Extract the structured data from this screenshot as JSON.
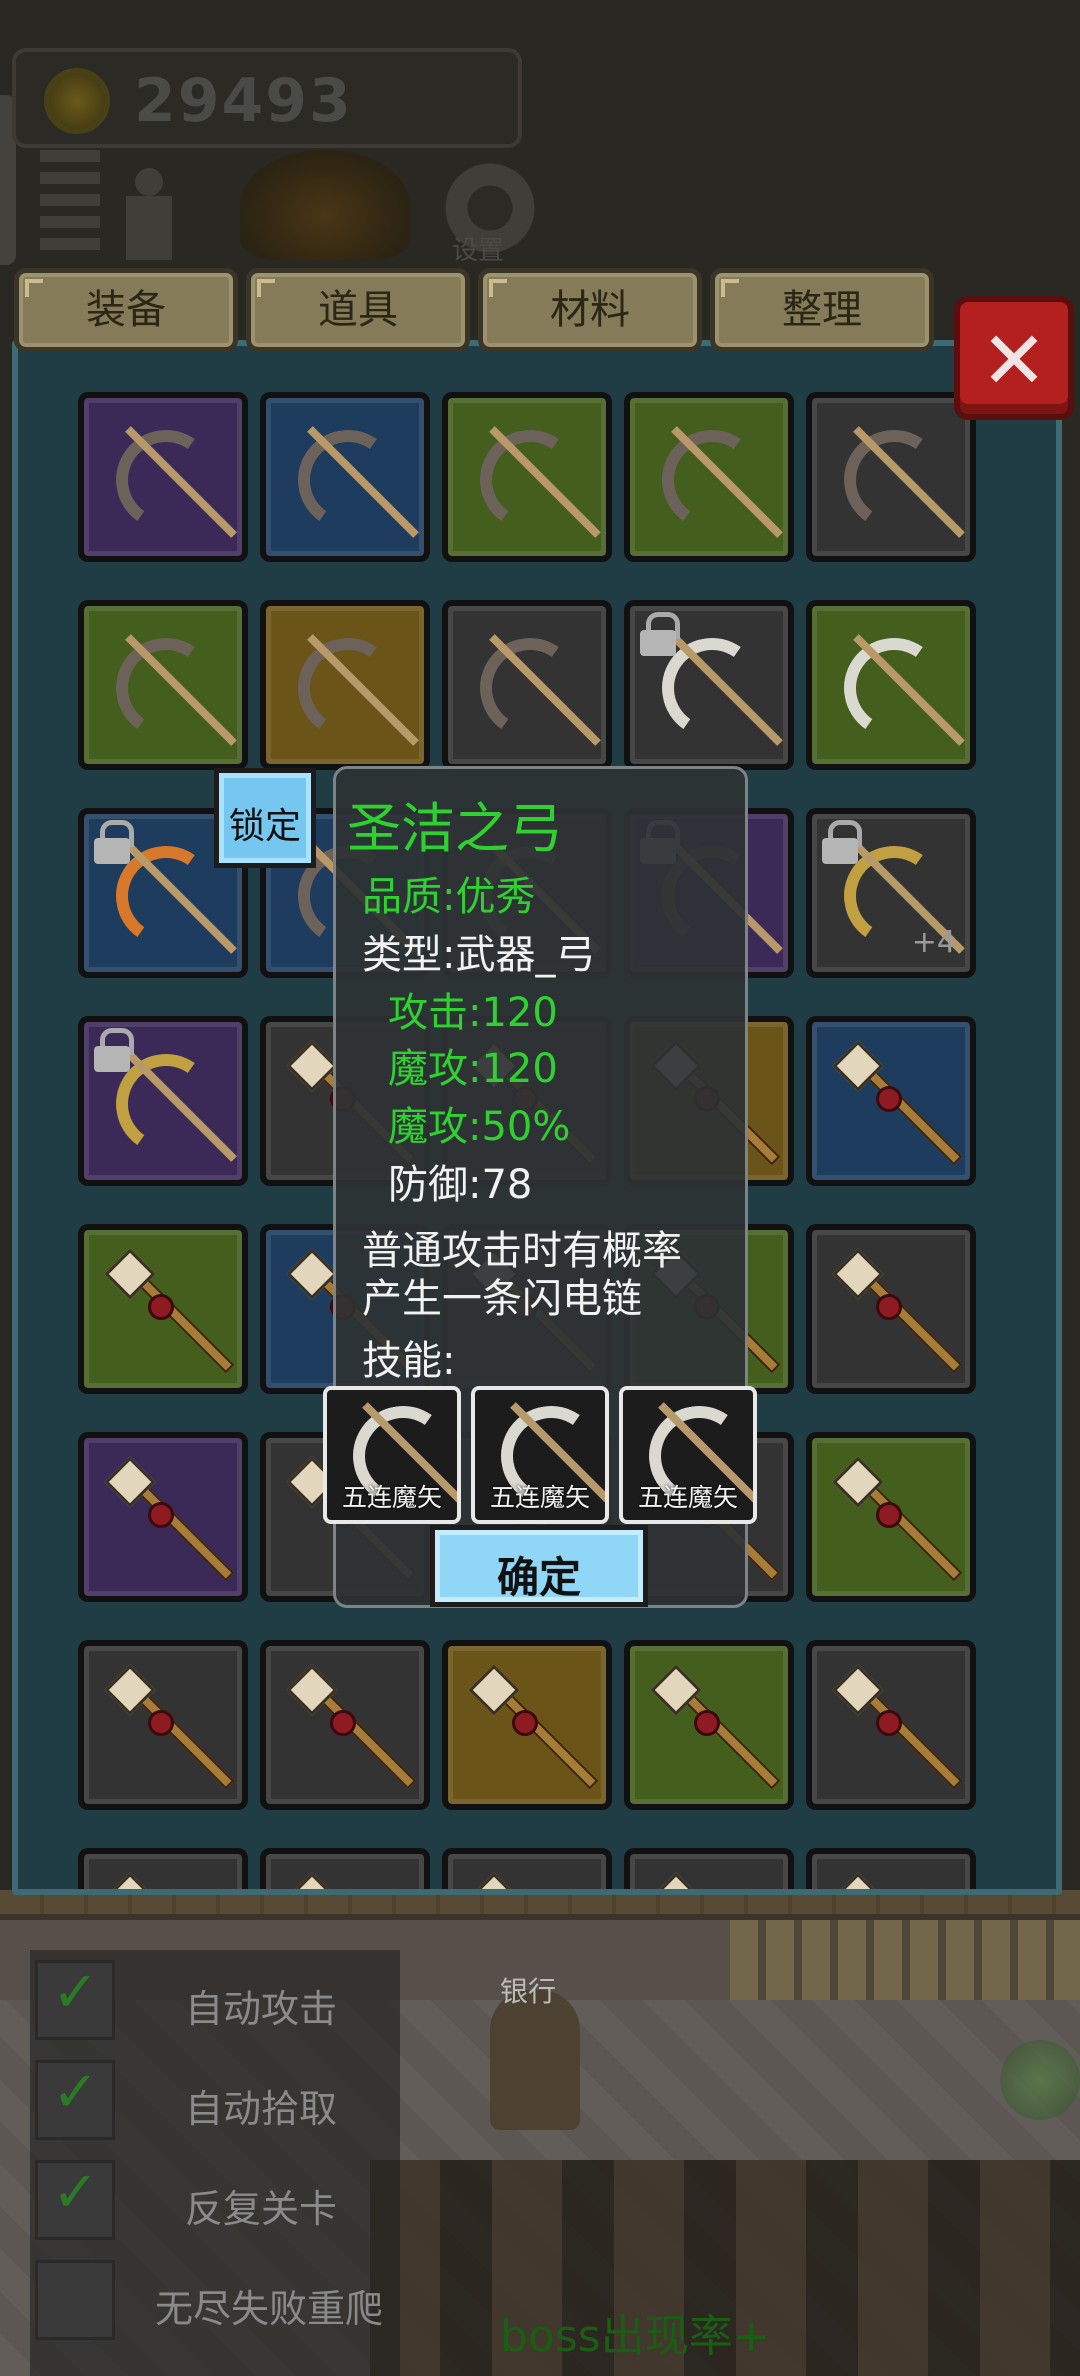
{
  "hud": {
    "gold": "29493",
    "settings_label": "设置"
  },
  "tabs": [
    "装备",
    "道具",
    "材料",
    "整理"
  ],
  "close_label": "✕",
  "grid": {
    "rows": [
      [
        {
          "q": "purple",
          "icon": "bow",
          "arc": "dark"
        },
        {
          "q": "blue",
          "icon": "bow",
          "arc": "dark"
        },
        {
          "q": "green",
          "icon": "bow",
          "arc": "dark"
        },
        {
          "q": "green",
          "icon": "bow",
          "arc": "dark"
        },
        {
          "q": "gray",
          "icon": "bow",
          "arc": "dark"
        }
      ],
      [
        {
          "q": "green",
          "icon": "bow",
          "arc": "dark"
        },
        {
          "q": "gold",
          "icon": "bow",
          "arc": "dark"
        },
        {
          "q": "gray",
          "icon": "bow",
          "arc": "dark"
        },
        {
          "q": "gray",
          "icon": "bow",
          "arc": "white",
          "locked": true
        },
        {
          "q": "green",
          "icon": "bow",
          "arc": "white"
        }
      ],
      [
        {
          "q": "blue",
          "icon": "bow",
          "arc": "fire",
          "locked": true
        },
        {
          "q": "blue",
          "icon": "bow",
          "arc": "dark"
        },
        {
          "q": "gray",
          "icon": "bow",
          "arc": "dark"
        },
        {
          "q": "purple",
          "icon": "bow",
          "arc": "dark",
          "locked": true
        },
        {
          "q": "gray",
          "icon": "bow",
          "arc": "gold",
          "locked": true,
          "plus": "+4"
        }
      ],
      [
        {
          "q": "purple",
          "icon": "bow",
          "arc": "gold",
          "locked": true
        },
        {
          "q": "gray",
          "icon": "staff"
        },
        {
          "q": "gray",
          "icon": "staff"
        },
        {
          "q": "gold",
          "icon": "staff"
        },
        {
          "q": "blue",
          "icon": "staff"
        }
      ],
      [
        {
          "q": "green",
          "icon": "staff"
        },
        {
          "q": "blue",
          "icon": "staff"
        },
        {
          "q": "gray",
          "icon": "staff"
        },
        {
          "q": "green",
          "icon": "staff"
        },
        {
          "q": "gray",
          "icon": "staff"
        }
      ],
      [
        {
          "q": "purple",
          "icon": "staff"
        },
        {
          "q": "gray",
          "icon": "staff"
        },
        {
          "q": "gray",
          "icon": "staff"
        },
        {
          "q": "gray",
          "icon": "staff"
        },
        {
          "q": "green",
          "icon": "staff"
        }
      ],
      [
        {
          "q": "gray",
          "icon": "staff"
        },
        {
          "q": "gray",
          "icon": "staff"
        },
        {
          "q": "gold",
          "icon": "staff"
        },
        {
          "q": "green",
          "icon": "staff"
        },
        {
          "q": "gray",
          "icon": "staff"
        }
      ],
      [
        {
          "q": "gray",
          "icon": "staff"
        },
        {
          "q": "gray",
          "icon": "staff"
        },
        {
          "q": "gray",
          "icon": "staff"
        },
        {
          "q": "gray",
          "icon": "staff"
        },
        {
          "q": "gray",
          "icon": "staff"
        }
      ]
    ]
  },
  "tooltip": {
    "lock_label": "锁定",
    "name": "圣洁之弓",
    "quality": "品质:优秀",
    "type": "类型:武器_弓",
    "attack": "攻击:120",
    "magic_attack": "魔攻:120",
    "magic_attack_pct": "魔攻:50%",
    "defense": "防御:78",
    "desc_line1": "普通攻击时有概率",
    "desc_line2": "产生一条闪电链",
    "skills_label": "技能:",
    "skills": [
      "五连魔矢",
      "五连魔矢",
      "五连魔矢"
    ],
    "confirm_label": "确定"
  },
  "scene": {
    "bank_label": "银行",
    "boss_text": "boss出现率+",
    "toggles": [
      {
        "label": "自动攻击",
        "checked": true
      },
      {
        "label": "自动拾取",
        "checked": true
      },
      {
        "label": "反复关卡",
        "checked": true
      },
      {
        "label": "无尽失败重爬",
        "checked": false
      }
    ]
  },
  "colors": {
    "panel": "#203d46",
    "tooltip_green": "#2ed130",
    "close_red": "#b3201e",
    "button_blue": "#8fd6f7"
  }
}
